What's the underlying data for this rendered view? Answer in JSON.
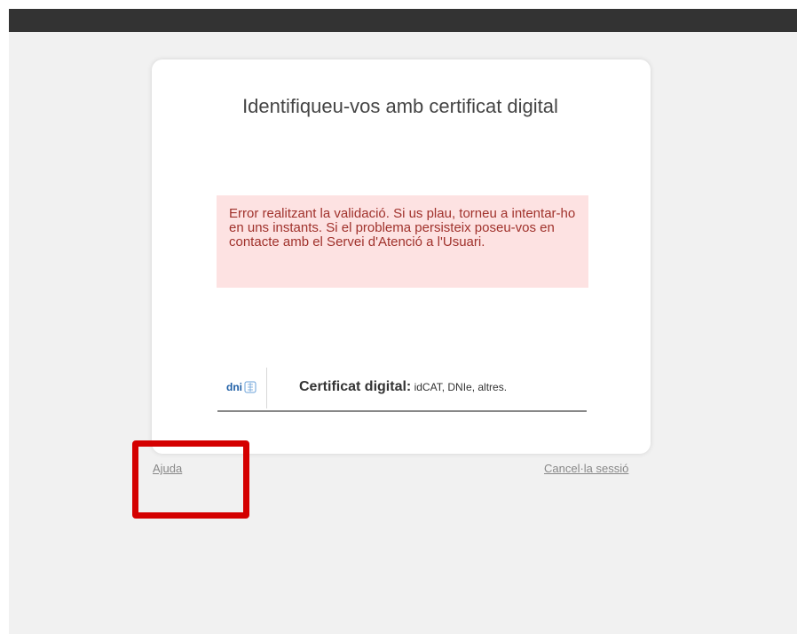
{
  "colors": {
    "top_bar": "#333333",
    "page_background": "#f1f1f1",
    "error_background": "#fde2e2",
    "error_text": "#a0322c",
    "highlight_border": "#d40000",
    "dni_logo": "#1f5fa6"
  },
  "login": {
    "title": "Identifiqueu-vos amb certificat digital",
    "error_message": "Error realitzant la validació. Si us plau, torneu a intentar-ho en uns instants. Si el problema persisteix poseu-vos en contacte amb el Servei d'Atenció a l'Usuari."
  },
  "certificate_option": {
    "logo_text": "dni",
    "logo_icon": "dnie-chip-icon",
    "label_strong": "Certificat digital:",
    "label_detail": " idCAT, DNIe, altres."
  },
  "footer": {
    "help_link": "Ajuda",
    "cancel_link": "Cancel·la sessió"
  }
}
